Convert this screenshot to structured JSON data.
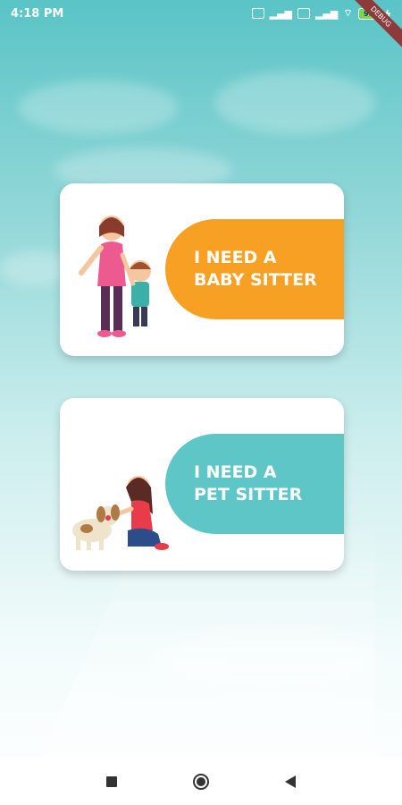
{
  "status": {
    "time": "4:18 PM",
    "battery": "98",
    "network_label": "4G"
  },
  "debug_banner": "DEBUG",
  "options": [
    {
      "line1": "I NEED A",
      "line2": "BABY SITTER",
      "icon": "mother-child-illustration",
      "color": "#f8a023"
    },
    {
      "line1": "I NEED A",
      "line2": "PET SITTER",
      "icon": "girl-dog-illustration",
      "color": "#5fc6c8"
    }
  ],
  "nav": {
    "recent": "square-icon",
    "home": "circle-icon",
    "back": "triangle-back-icon"
  }
}
